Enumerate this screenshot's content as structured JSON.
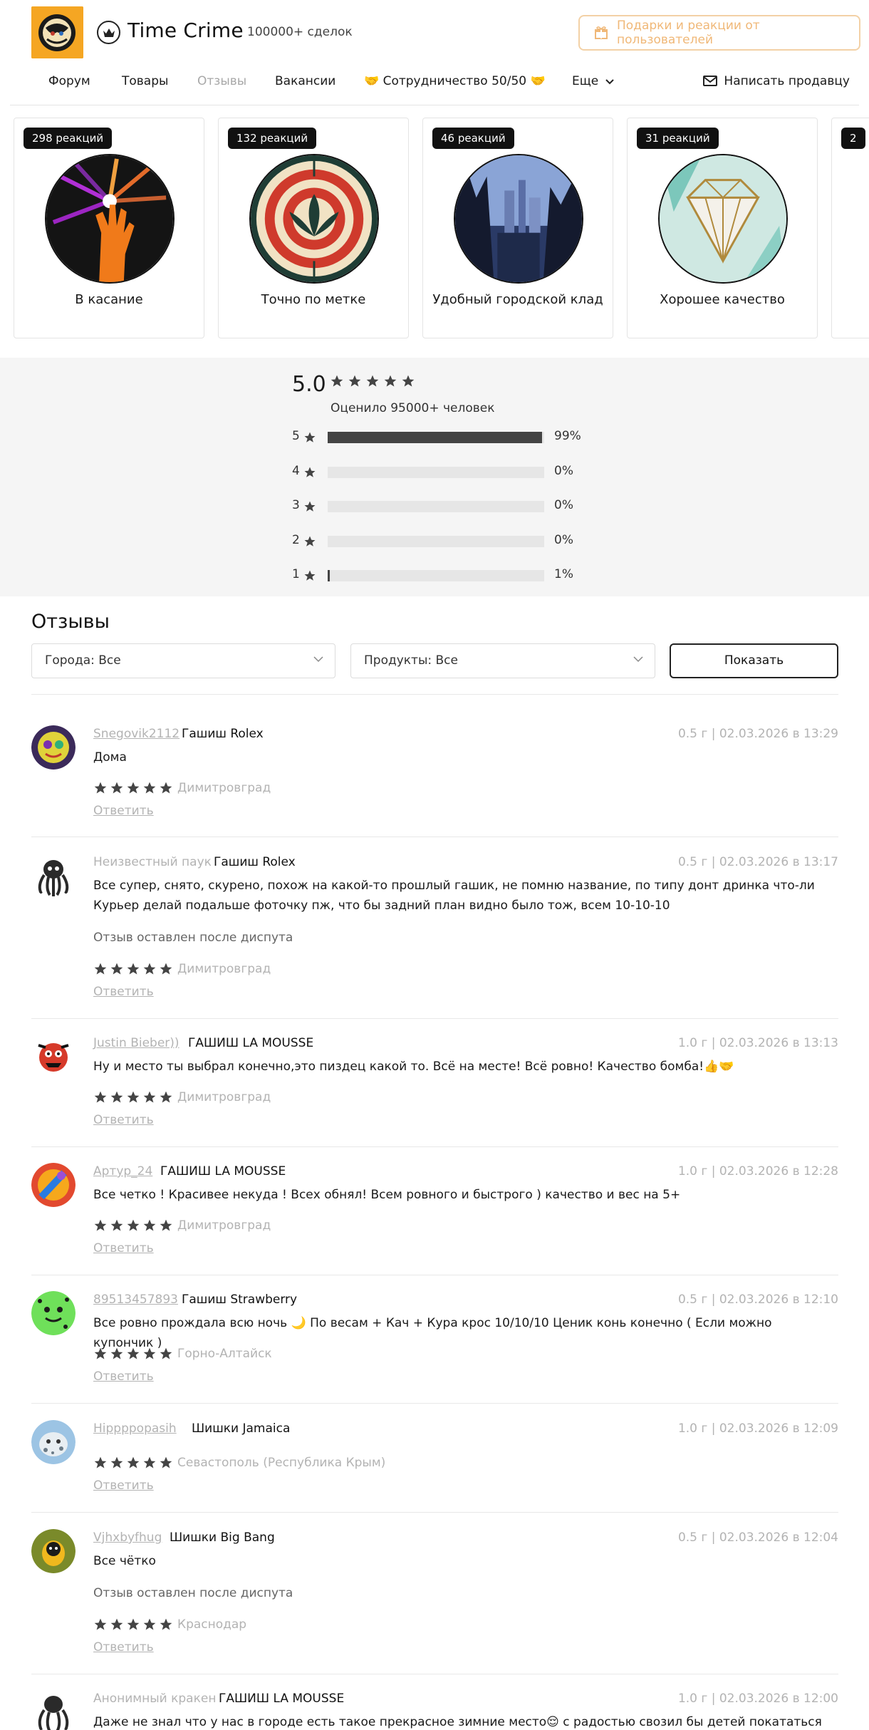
{
  "header": {
    "logo_alt": "Time Crime logo",
    "shop_name": "Time Crime",
    "deals": "100000+ сделок",
    "gift_button": "Подарки и реакции от пользователей"
  },
  "nav": {
    "items": [
      "Форум",
      "Товары",
      "Отзывы",
      "Вакансии",
      "🤝 Сотрудничество 50/50 🤝",
      "Еще"
    ],
    "active": "Отзывы",
    "message_seller": "Написать продавцу"
  },
  "reactions": [
    {
      "badge": "298 реакций",
      "title": "В касание"
    },
    {
      "badge": "132 реакций",
      "title": "Точно по метке"
    },
    {
      "badge": "46 реакций",
      "title": "Удобный городской клад"
    },
    {
      "badge": "31 реакций",
      "title": "Хорошее качество"
    },
    {
      "badge": "2",
      "title": ""
    }
  ],
  "rating": {
    "average": "5.0",
    "rated_by": "Оценило 95000+ человек",
    "rows": [
      {
        "stars": "5",
        "percent": 99,
        "label": "99%"
      },
      {
        "stars": "4",
        "percent": 0,
        "label": "0%"
      },
      {
        "stars": "3",
        "percent": 0,
        "label": "0%"
      },
      {
        "stars": "2",
        "percent": 0,
        "label": "0%"
      },
      {
        "stars": "1",
        "percent": 1,
        "label": "1%"
      }
    ]
  },
  "reviews_section": {
    "title": "Отзывы",
    "city_filter": "Города: Все",
    "product_filter": "Продукты: Все",
    "show_button": "Показать",
    "reply_label": "Ответить",
    "items": [
      {
        "author": "Snegovik2112",
        "product": "Гашиш Rolex",
        "meta": "0.5 г | 02.03.2026 в 13:29",
        "text": "Дома",
        "note": "",
        "rating": 5,
        "city": "Димитровград"
      },
      {
        "author": "Неизвестный паук",
        "product": "Гашиш Rolex",
        "meta": "0.5 г | 02.03.2026 в 13:17",
        "text": "Все супер, снято, скурено, похож на какой-то прошлый гашик, не помню название, по типу донт дринка что-ли Курьер делай подальше фоточку пж, что бы задний план видно было тож, всем 10-10-10",
        "note": "Отзыв оставлен после диспута",
        "rating": 5,
        "city": "Димитровград"
      },
      {
        "author": "Justin Bieber))",
        "product": "ГАШИШ LA MOUSSE",
        "meta": "1.0 г | 02.03.2026 в 13:13",
        "text": "Ну и место ты выбрал конечно,это пиздец какой то. Всё на месте! Всё ровно! Качество бомба!👍🤝",
        "note": "",
        "rating": 5,
        "city": "Димитровград"
      },
      {
        "author": "Артур_24",
        "product": "ГАШИШ LA MOUSSE",
        "meta": "1.0 г | 02.03.2026 в 12:28",
        "text": "Все четко ! Красивее некуда ! Всех обнял! Всем ровного и быстрого ) качество и вес на 5+",
        "note": "",
        "rating": 5,
        "city": "Димитровград"
      },
      {
        "author": "89513457893",
        "product": "Гашиш Strawberry",
        "meta": "0.5 г | 02.03.2026 в 12:10",
        "text": "Все ровно прождала всю ночь 🌙 По весам + Кач + Кура крос 10/10/10 Ценик конь конечно ( Если можно купончик )",
        "note": "",
        "rating": 5,
        "city": "Горно-Алтайск"
      },
      {
        "author": "Hippppopasih",
        "product": "Шишки Jamaica",
        "meta": "1.0 г | 02.03.2026 в 12:09",
        "text": "",
        "note": "",
        "rating": 5,
        "city": "Севастополь (Республика Крым)"
      },
      {
        "author": "Vjhxbyfhug",
        "product": "Шишки Big Bang",
        "meta": "0.5 г | 02.03.2026 в 12:04",
        "text": "Все чётко",
        "note": "Отзыв оставлен после диспута",
        "rating": 5,
        "city": "Краснодар"
      },
      {
        "author": "Анонимный кракен",
        "product": "ГАШИШ LA MOUSSE",
        "meta": "1.0 г | 02.03.2026 в 12:00",
        "text": "Даже не знал что у нас в городе есть такое прекрасное зимние место😌 с радостью свозил бы детей покататься на",
        "note": "",
        "rating": 5,
        "city": ""
      }
    ]
  },
  "colors": {
    "accent": "#f5a623",
    "gift_text": "#f0b878",
    "muted": "#b3b3b3",
    "panel": "#f5f5f5"
  },
  "icons": [
    "crown-icon",
    "gift-icon",
    "mail-icon",
    "chevron-down-icon",
    "star-icon"
  ]
}
